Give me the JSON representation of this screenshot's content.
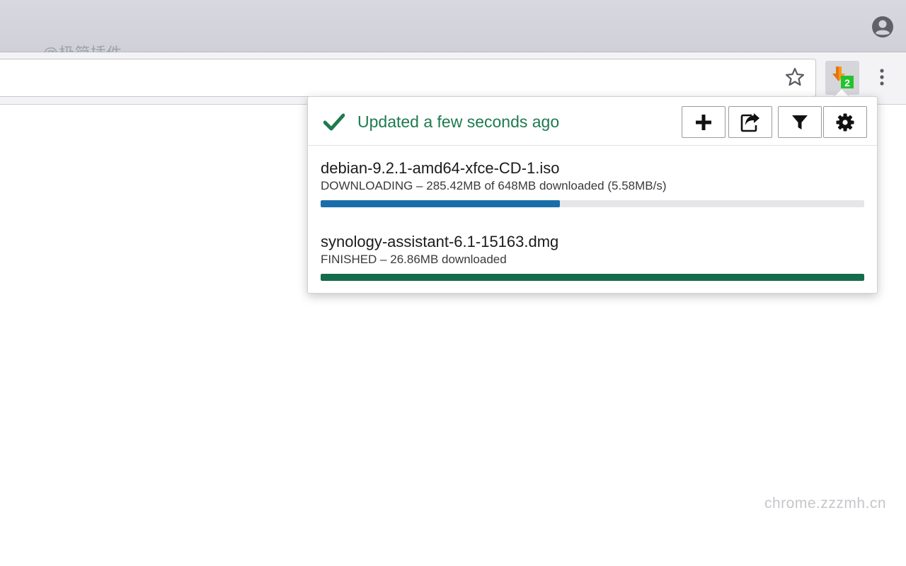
{
  "browser": {
    "left_edge_glyph": "/",
    "top_watermark": "@极简插件",
    "icons": {
      "profile": "account-circle-icon",
      "bookmark": "star-outline-icon",
      "extension": "download-station-icon",
      "menu": "vertical-dots-icon"
    },
    "extension_badge": "2"
  },
  "popup": {
    "status": {
      "icon": "checkmark-icon",
      "text": "Updated a few seconds ago",
      "color": "#1e7a4f"
    },
    "toolbar": {
      "add_icon": "plus-icon",
      "open_icon": "external-link-icon",
      "filter_icon": "filter-funnel-icon",
      "settings_icon": "gear-icon"
    },
    "tasks": [
      {
        "name": "debian-9.2.1-amd64-xfce-CD-1.iso",
        "status": "DOWNLOADING – 285.42MB of 648MB downloaded (5.58MB/s)",
        "progress_percent": 44,
        "bar_color": "#1a6ea8"
      },
      {
        "name": "synology-assistant-6.1-15163.dmg",
        "status": "FINISHED – 26.86MB downloaded",
        "progress_percent": 100,
        "bar_color": "#146c4c"
      }
    ]
  },
  "page": {
    "bottom_watermark": "chrome.zzzmh.cn"
  }
}
